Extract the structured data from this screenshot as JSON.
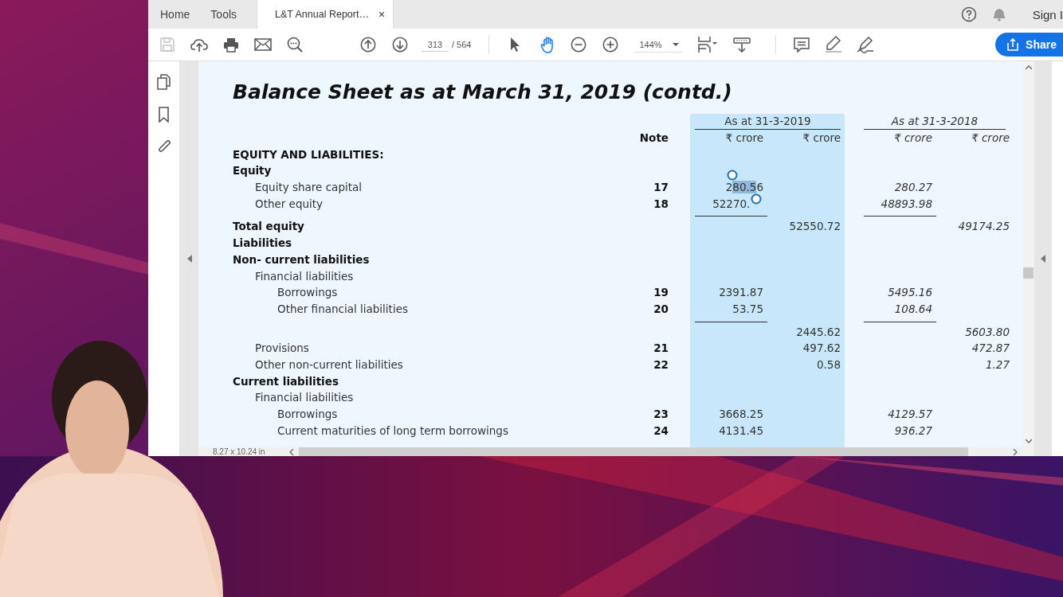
{
  "tabs": [
    {
      "label": "Home",
      "selected": false
    },
    {
      "label": "Tools",
      "selected": false
    },
    {
      "label": "L&T Annual Report…",
      "selected": true,
      "close": "×"
    }
  ],
  "account": {
    "sign_in": "Sign I"
  },
  "toolbar": {
    "save": {
      "disabled": true
    },
    "page": {
      "value": "313",
      "total": "/ 564"
    },
    "tools": [
      {
        "kind": "select",
        "selected": false
      },
      {
        "kind": "hand",
        "selected": true
      }
    ],
    "zoom": "144%",
    "share": "Share"
  },
  "document": {
    "title": "Balance Sheet as at March 31, 2019 (contd.)",
    "note_heading": "Note",
    "periods": [
      {
        "label": "As at 31-3-2019",
        "highlighted": true,
        "units": [
          "₹ crore",
          "₹ crore"
        ]
      },
      {
        "label": "As at 31-3-2018",
        "highlighted": false,
        "units": [
          "₹ crore",
          "₹ crore"
        ]
      }
    ],
    "rows": [
      {
        "label": "EQUITY AND LIABILITIES:"
      },
      {
        "label": "Equity",
        "children": [
          {
            "label": "Equity share capital",
            "note": "17",
            "values": {
              "current_items": {
                "before": "2",
                "selected": "80.5",
                "after": "6"
              },
              "prior_items": "280.27"
            }
          },
          {
            "label": "Other equity",
            "note": "18",
            "values": {
              "current_items": "52270.",
              "prior_items": "48893.98"
            },
            "rule_below": true
          }
        ]
      },
      {
        "label": "Total equity",
        "values": {
          "current_total": "52550.72",
          "prior_total": "49174.25"
        }
      },
      {
        "label": "Liabilities"
      },
      {
        "label": "Non- current liabilities",
        "children": [
          {
            "label": "Financial liabilities",
            "children": [
              {
                "label": "Borrowings",
                "note": "19",
                "values": {
                  "current_items": "2391.87",
                  "prior_items": "5495.16"
                }
              },
              {
                "label": "Other financial liabilities",
                "note": "20",
                "values": {
                  "current_items": "53.75",
                  "prior_items": "108.64"
                },
                "rule_below": true
              }
            ]
          },
          {
            "values": {
              "current_total": "2445.62",
              "prior_total": "5603.80"
            }
          },
          {
            "label": "Provisions",
            "note": "21",
            "values": {
              "current_total": "497.62",
              "prior_total": "472.87"
            }
          },
          {
            "label": "Other non-current liabilities",
            "note": "22",
            "values": {
              "current_total": "0.58",
              "prior_total": "1.27"
            }
          }
        ]
      },
      {
        "label": "Current liabilities",
        "children": [
          {
            "label": "Financial liabilities",
            "children": [
              {
                "label": "Borrowings",
                "note": "23",
                "values": {
                  "current_items": "3668.25",
                  "prior_items": "4129.57"
                }
              },
              {
                "label": "Current maturities of long term borrowings",
                "note": "24",
                "values": {
                  "current_items": "4131.45",
                  "prior_items": "936.27"
                }
              }
            ]
          }
        ]
      }
    ]
  },
  "status": {
    "page_size": "8.27 x 10.24 in"
  }
}
